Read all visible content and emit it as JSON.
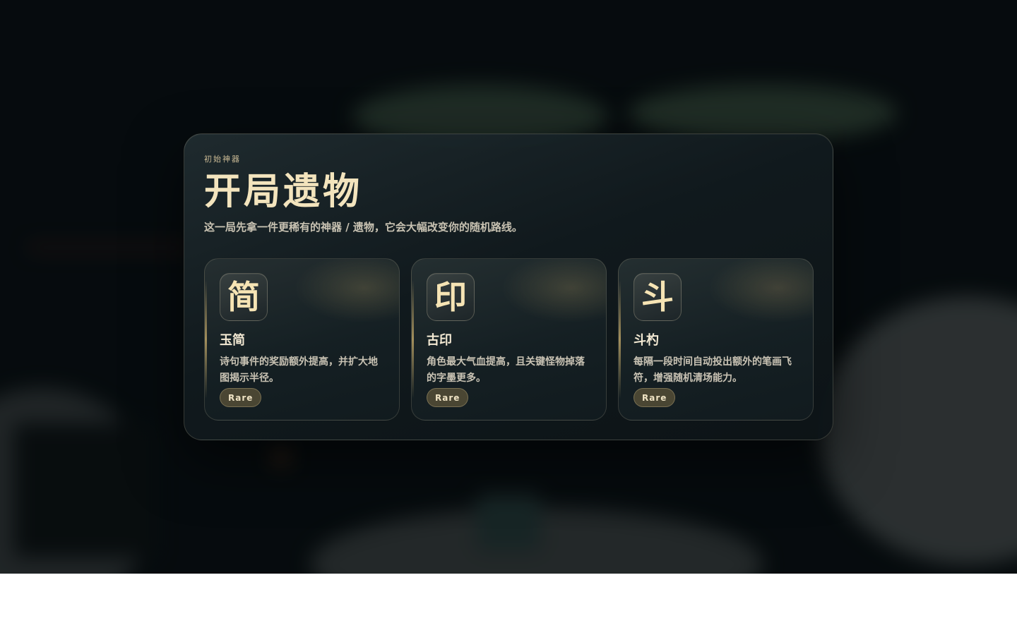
{
  "modal": {
    "eyebrow": "初始神器",
    "title": "开局遗物",
    "subtitle": "这一局先拿一件更稀有的神器 / 遗物，它会大幅改变你的随机路线。"
  },
  "relics": [
    {
      "glyph": "简",
      "name": "玉简",
      "description": "诗句事件的奖励额外提高，并扩大地图揭示半径。",
      "rarity": "Rare"
    },
    {
      "glyph": "印",
      "name": "古印",
      "description": "角色最大气血提高，且关键怪物掉落的字墨更多。",
      "rarity": "Rare"
    },
    {
      "glyph": "斗",
      "name": "斗杓",
      "description": "每隔一段时间自动投出额外的笔画飞符，增强随机清场能力。",
      "rarity": "Rare"
    }
  ],
  "colors": {
    "title": "#f3e4bd",
    "accent_gold": "#c9b994",
    "badge_bg": "#5c543a",
    "panel_bg": "#111a1e"
  }
}
